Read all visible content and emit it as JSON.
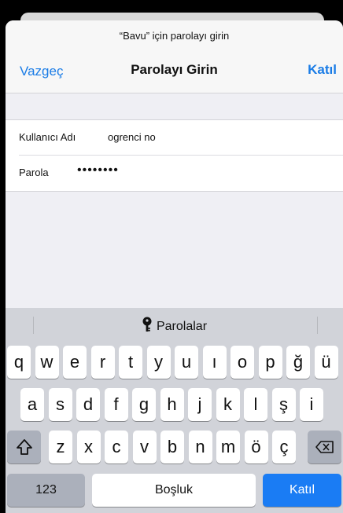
{
  "dialog": {
    "prompt": "“Bavu” için parolayı girin",
    "cancel_label": "Vazgeç",
    "title": "Parolayı Girin",
    "join_label": "Katıl"
  },
  "form": {
    "username_label": "Kullanıcı Adı",
    "username_value": "ogrenci no",
    "password_label": "Parola",
    "password_value": "••••••••"
  },
  "keyboard": {
    "suggestion_label": "Parolalar",
    "row1": [
      "q",
      "w",
      "e",
      "r",
      "t",
      "y",
      "u",
      "ı",
      "o",
      "p",
      "ğ",
      "ü"
    ],
    "row2": [
      "a",
      "s",
      "d",
      "f",
      "g",
      "h",
      "j",
      "k",
      "l",
      "ş",
      "i"
    ],
    "row3": [
      "z",
      "x",
      "c",
      "v",
      "b",
      "n",
      "m",
      "ö",
      "ç"
    ],
    "numbers_label": "123",
    "space_label": "Boşluk",
    "return_label": "Katıl"
  },
  "icons": [
    "key-icon",
    "shift-icon",
    "backspace-icon"
  ]
}
